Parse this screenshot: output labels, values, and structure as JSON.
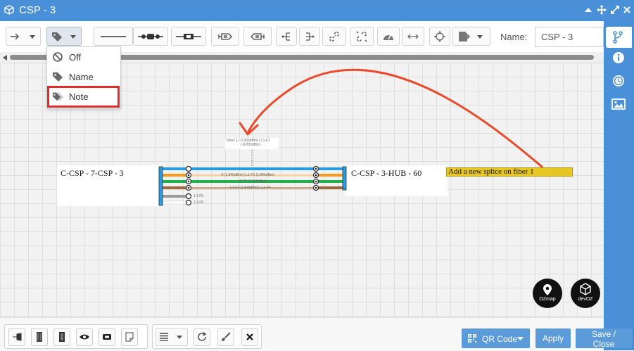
{
  "window": {
    "title": "CSP - 3"
  },
  "toolbar": {
    "name_label": "Name:",
    "name_value": "CSP - 3"
  },
  "label_menu": {
    "items": [
      {
        "label": "Off",
        "icon": "off-icon"
      },
      {
        "label": "Name",
        "icon": "tag-icon"
      },
      {
        "label": "Note",
        "icon": "tags-icon"
      }
    ],
    "highlighted": "Note"
  },
  "diagram": {
    "left_cable": "C-CSP - 7-CSP - 3",
    "right_cable": "C-CSP - 3-HUB - 60",
    "note": "Add a new splice on fiber 1",
    "fiber_tooltip_line1": "Fiber 1 (-3.303dBm) | L1-F1",
    "fiber_tooltip_line2": "(-6.003dBm)",
    "splice_labels": [
      "-2 (1.846dBm) | L1-F2 (1.846dBm)",
      "L1-F3 (1.846dBm)",
      "L1-F4 (1.846dBm) | L1-F4"
    ],
    "loose_labels": [
      "L1-F5",
      "L1-F6"
    ],
    "fiber_colors": [
      "#2a9be0",
      "#f59a1f",
      "#22b04a",
      "#a0683a",
      "#9a9a9a",
      "#ffffff"
    ],
    "annotation_color": "#ea4a2a"
  },
  "logos": {
    "ozmap": "OZmap",
    "devoz": "devOZ"
  },
  "footer": {
    "qr_label": "QR Code",
    "apply_label": "Apply",
    "save_label": "Save / Close"
  }
}
